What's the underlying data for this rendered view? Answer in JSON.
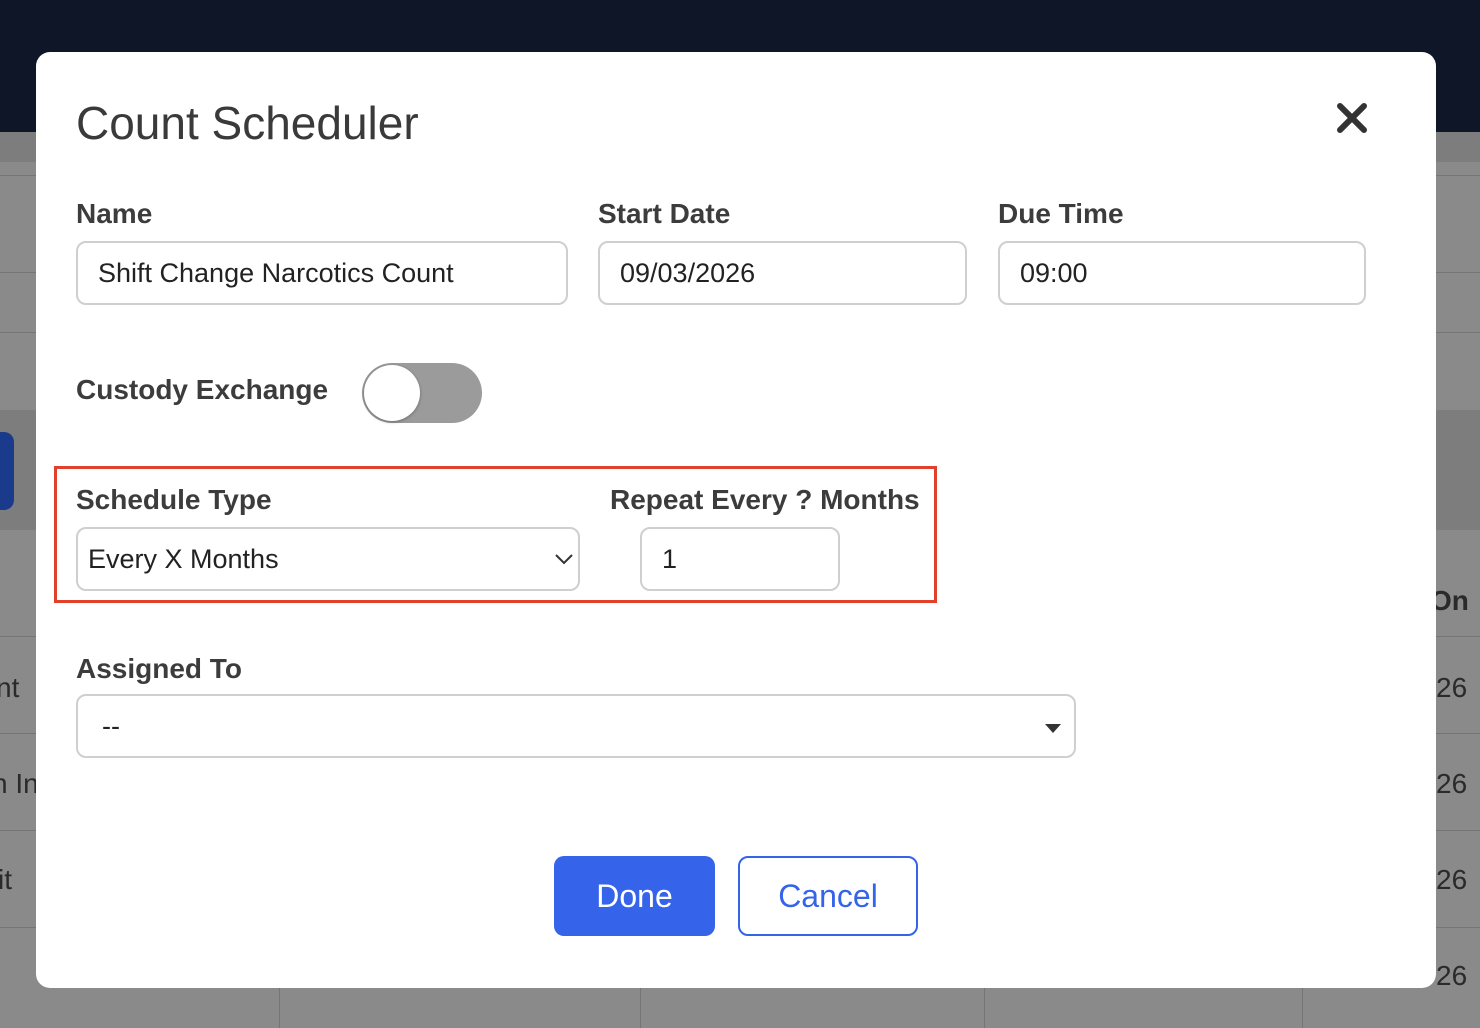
{
  "background": {
    "left_fragments": [
      "nt",
      "n In",
      "it"
    ],
    "right_header": "On",
    "right_fragments": [
      "26",
      "26",
      "26",
      "26"
    ]
  },
  "modal": {
    "title": "Count Scheduler",
    "close_icon": "close-icon",
    "fields": {
      "name": {
        "label": "Name",
        "value": "Shift Change Narcotics Count"
      },
      "start_date": {
        "label": "Start Date",
        "value": "09/03/2026"
      },
      "due_time": {
        "label": "Due Time",
        "value": "09:00"
      },
      "custody_exchange": {
        "label": "Custody Exchange",
        "enabled": false
      },
      "schedule_type": {
        "label": "Schedule Type",
        "value": "Every X Months"
      },
      "repeat_every": {
        "label": "Repeat Every ? Months",
        "value": "1"
      },
      "assigned_to": {
        "label": "Assigned To",
        "value": "--"
      }
    },
    "buttons": {
      "done": "Done",
      "cancel": "Cancel"
    },
    "colors": {
      "primary": "#3563e9",
      "highlight": "#e0412b",
      "topbar": "#0e1628",
      "toggle_off": "#9b9b9b"
    }
  }
}
